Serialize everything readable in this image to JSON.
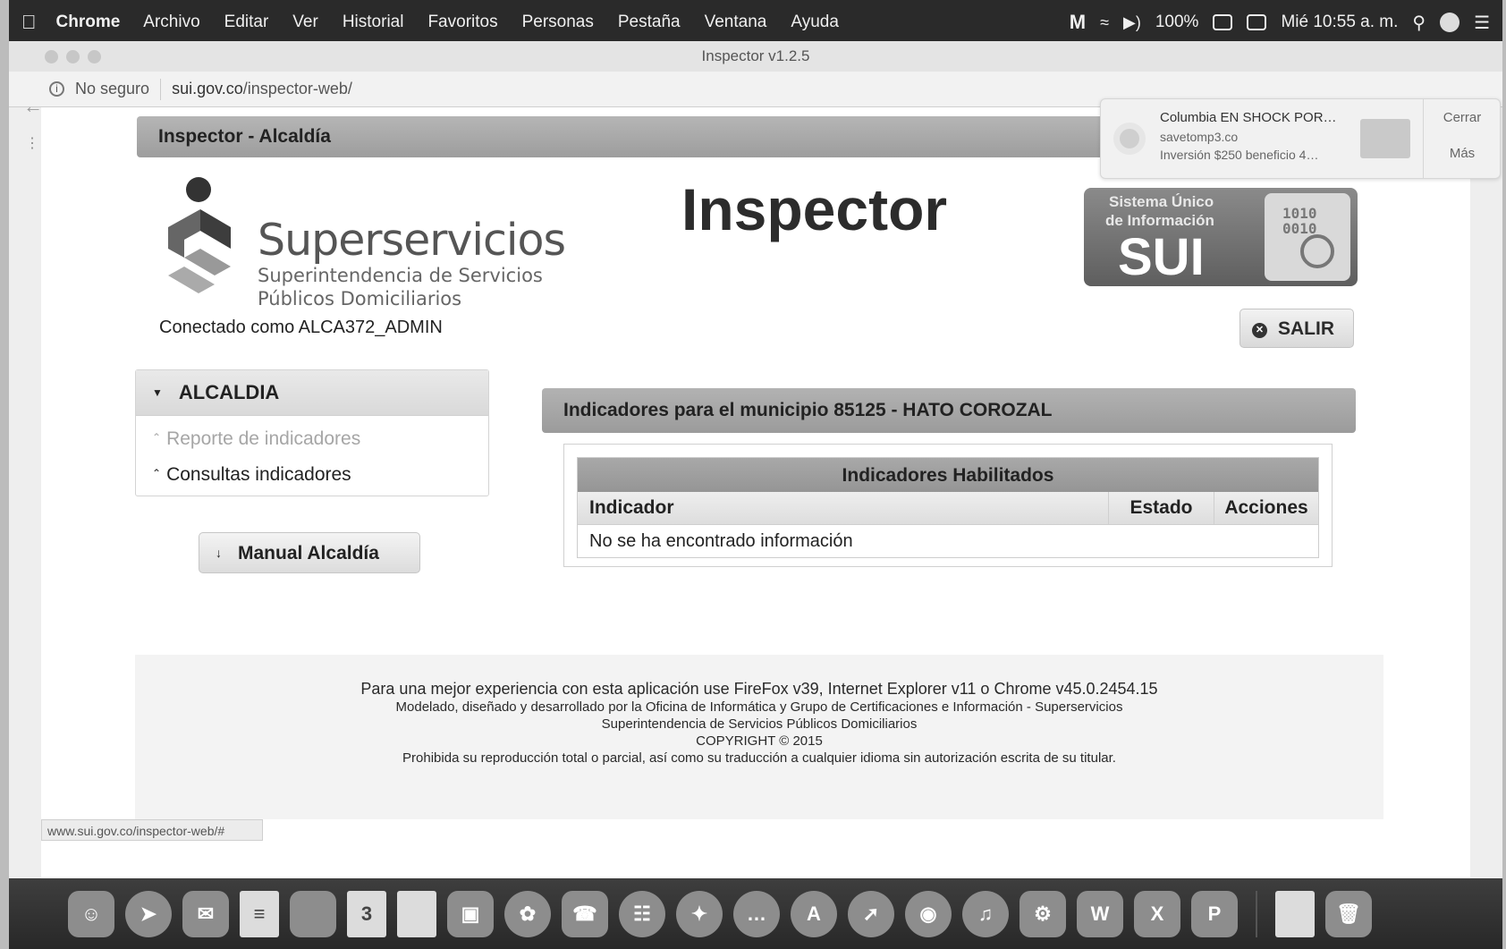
{
  "menubar": {
    "app": "Chrome",
    "items": [
      "Archivo",
      "Editar",
      "Ver",
      "Historial",
      "Favoritos",
      "Personas",
      "Pestaña",
      "Ventana",
      "Ayuda"
    ],
    "battery": "100%",
    "clock": "Mié 10:55 a. m."
  },
  "window": {
    "title": "Inspector v1.2.5"
  },
  "address": {
    "security": "No seguro",
    "domain": "sui.gov.co",
    "path": "/inspector-web/"
  },
  "notification": {
    "title": "Columbia EN SHOCK POR…",
    "site": "savetomp3.co",
    "body": "Inversión $250 beneficio 4…",
    "close": "Cerrar",
    "more": "Más"
  },
  "page": {
    "header": "Inspector - Alcaldía",
    "logo": {
      "name": "Superservicios",
      "sub1": "Superintendencia de Servicios",
      "sub2": "Públicos Domiciliarios"
    },
    "title": "Inspector",
    "sui_logo": {
      "line1": "Sistema Único",
      "line2": "de Información",
      "line3": "SUI",
      "bits1": "1010",
      "bits2": "0010"
    },
    "connected": "Conectado como ALCA372_ADMIN",
    "logout": "SALIR",
    "sidebar": {
      "heading": "ALCALDIA",
      "items": [
        "Reporte de indicadores",
        "Consultas indicadores"
      ]
    },
    "manual_button": "Manual Alcaldía",
    "indicators": {
      "header": "Indicadores para el municipio 85125 - HATO COROZAL",
      "caption": "Indicadores Habilitados",
      "columns": [
        "Indicador",
        "Estado",
        "Acciones"
      ],
      "empty": "No se ha encontrado información"
    },
    "footer": {
      "line1": "Para una mejor experiencia con esta aplicación use FireFox v39, Internet Explorer v11 o Chrome v45.0.2454.15",
      "line2": "Modelado, diseñado y desarrollado por la Oficina de Informática y Grupo de Certificaciones e Información - Superservicios",
      "line3": "Superintendencia de Servicios Públicos Domiciliarios",
      "line4": "COPYRIGHT © 2015",
      "line5": "Prohibida su reproducción total o parcial, así como su traducción a cualquier idioma sin autorización escrita de su titular."
    }
  },
  "statusbar": "www.sui.gov.co/inspector-web/#",
  "dock": {
    "calendar_day": "3",
    "word": "W",
    "excel": "X",
    "powerpoint": "P"
  }
}
